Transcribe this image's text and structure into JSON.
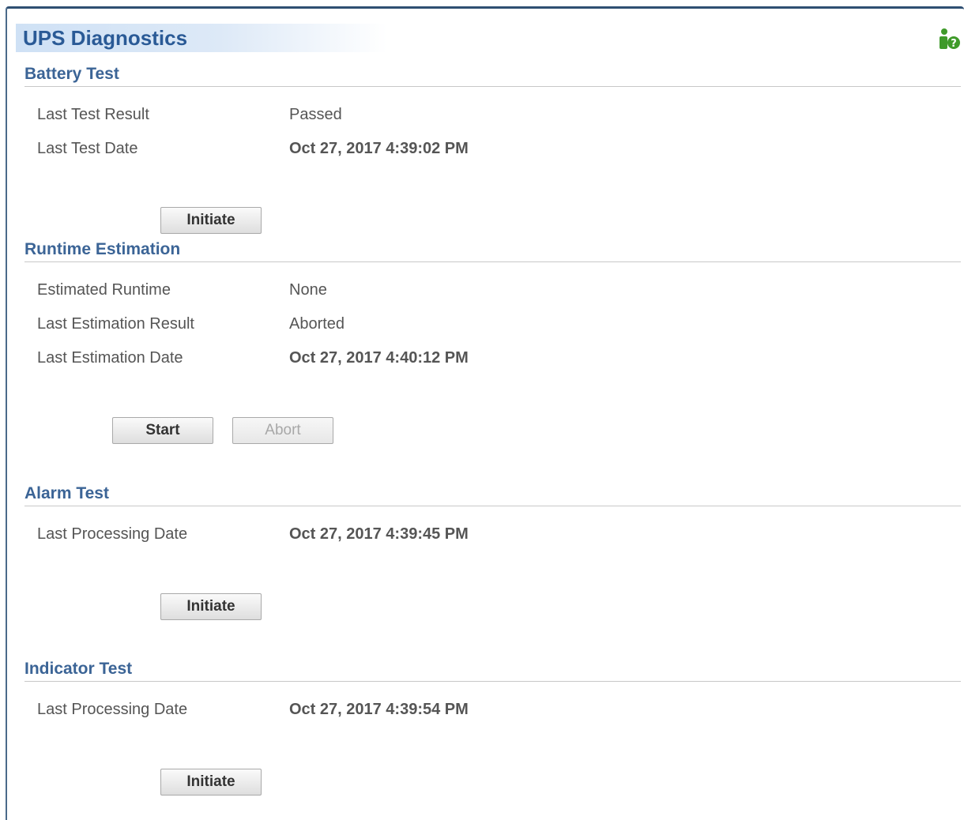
{
  "page": {
    "title": "UPS Diagnostics",
    "help_icon": "help-icon"
  },
  "battery_test": {
    "title": "Battery Test",
    "rows": [
      {
        "label": "Last Test Result",
        "value": "Passed"
      },
      {
        "label": "Last Test Date",
        "value": "Oct 27, 2017 4:39:02 PM"
      }
    ],
    "initiate_label": "Initiate"
  },
  "runtime_estimation": {
    "title": "Runtime Estimation",
    "rows": [
      {
        "label": "Estimated Runtime",
        "value": "None"
      },
      {
        "label": "Last Estimation Result",
        "value": "Aborted"
      },
      {
        "label": "Last Estimation Date",
        "value": "Oct 27, 2017 4:40:12 PM"
      }
    ],
    "start_label": "Start",
    "abort_label": "Abort"
  },
  "alarm_test": {
    "title": "Alarm Test",
    "rows": [
      {
        "label": "Last Processing Date",
        "value": "Oct 27, 2017 4:39:45 PM"
      }
    ],
    "initiate_label": "Initiate"
  },
  "indicator_test": {
    "title": "Indicator Test",
    "rows": [
      {
        "label": "Last Processing Date",
        "value": "Oct 27, 2017 4:39:54 PM"
      }
    ],
    "initiate_label": "Initiate"
  },
  "colors": {
    "title": "#2a5a96",
    "section": "#3b6496",
    "icon_green": "#3f9a2a"
  }
}
